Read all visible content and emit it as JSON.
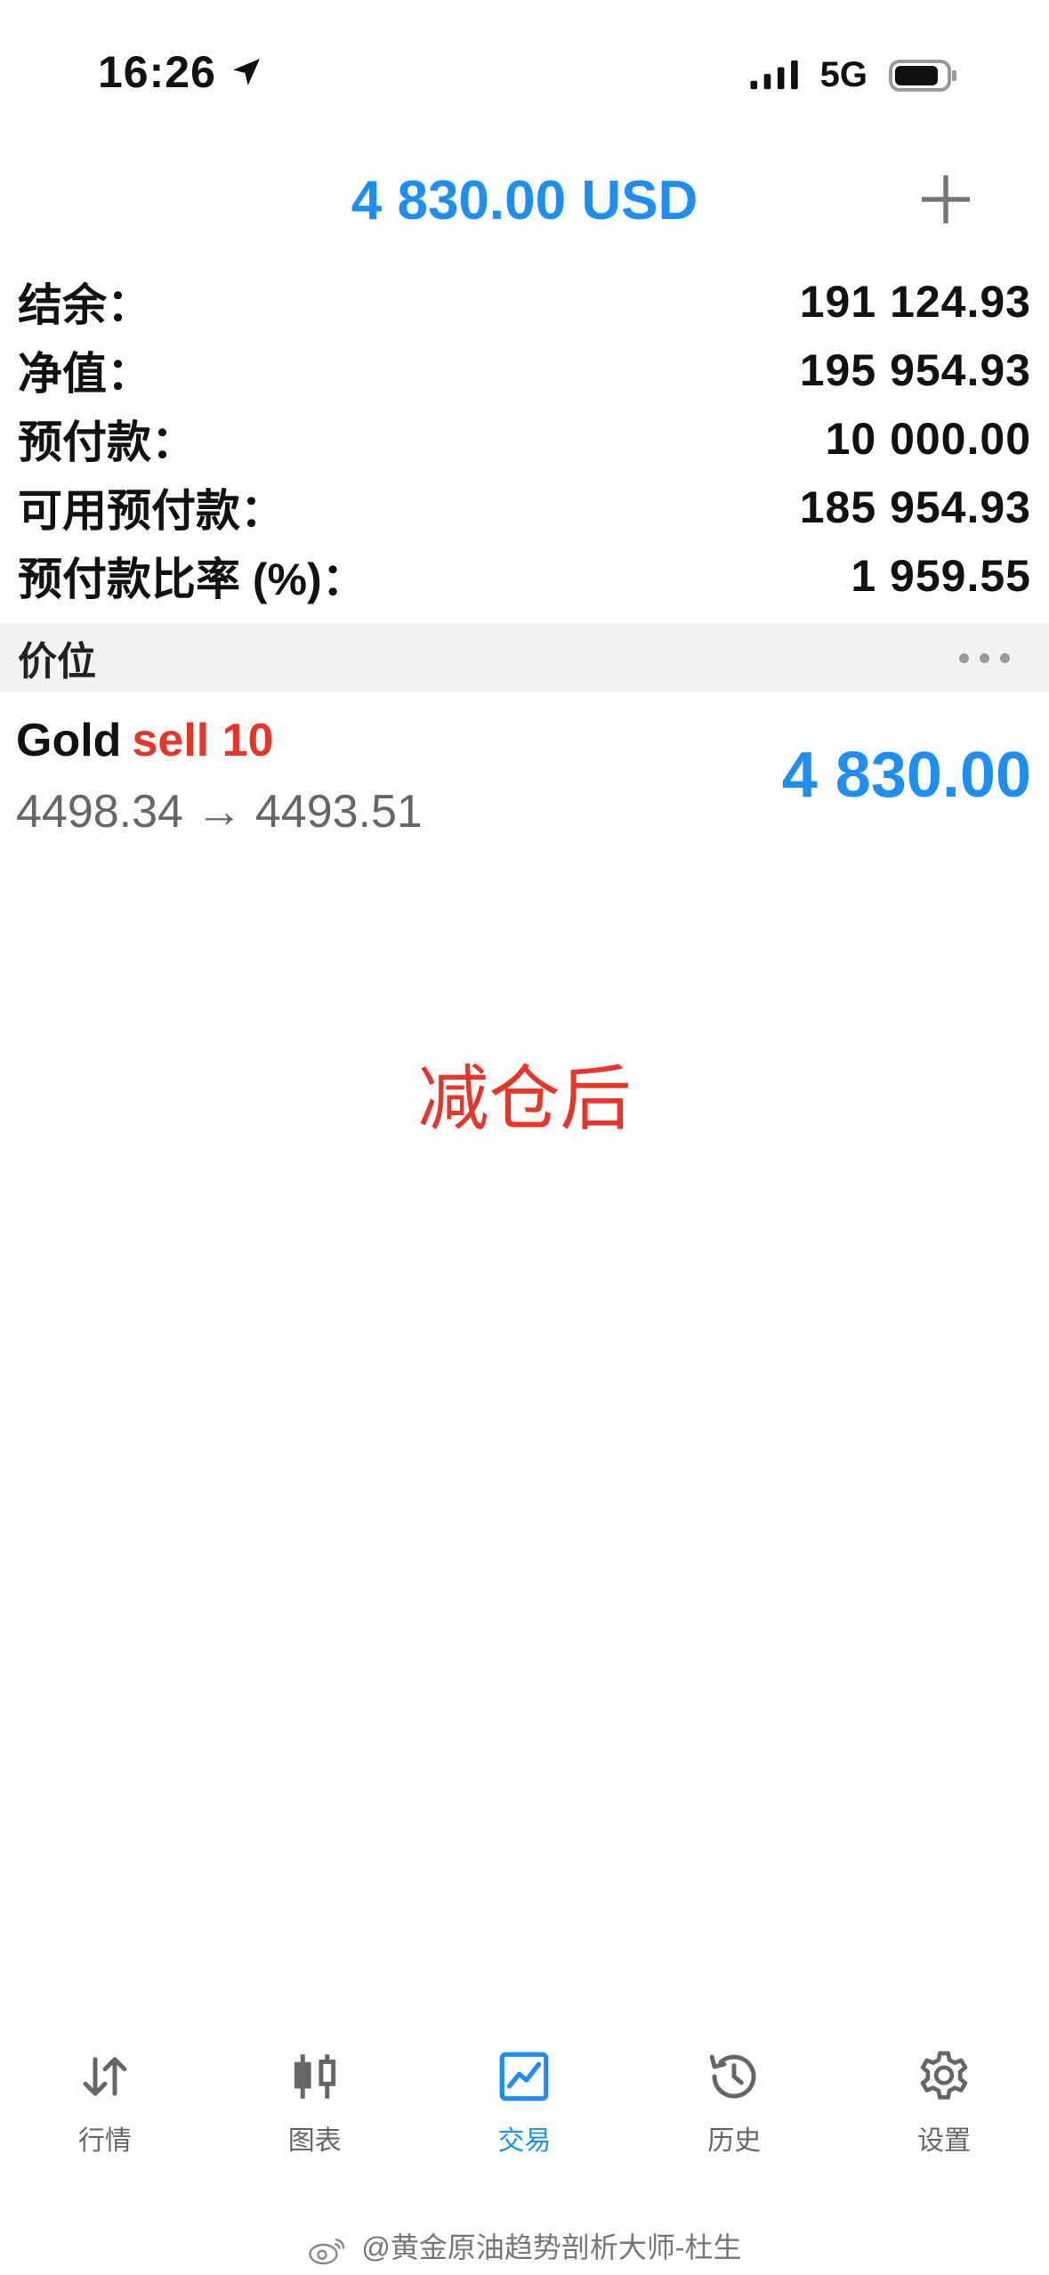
{
  "status_bar": {
    "time": "16:26",
    "network": "5G"
  },
  "header": {
    "title": "4 830.00 USD"
  },
  "summary": [
    {
      "label": "结余：",
      "value": "191 124.93"
    },
    {
      "label": "净值：",
      "value": "195 954.93"
    },
    {
      "label": "预付款：",
      "value": "10 000.00"
    },
    {
      "label": "可用预付款：",
      "value": "185 954.93"
    },
    {
      "label": "预付款比率 (%)：",
      "value": "1 959.55"
    }
  ],
  "section": {
    "title": "价位"
  },
  "position": {
    "symbol": "Gold",
    "side": "sell 10",
    "prices": "4498.34 → 4493.51",
    "profit": "4 830.00"
  },
  "caption": "减仓后",
  "tabs": [
    {
      "label": "行情",
      "icon": "quotes-arrows-icon",
      "active": false
    },
    {
      "label": "图表",
      "icon": "candlestick-chart-icon",
      "active": false
    },
    {
      "label": "交易",
      "icon": "trade-chart-icon",
      "active": true
    },
    {
      "label": "历史",
      "icon": "history-clock-icon",
      "active": false
    },
    {
      "label": "设置",
      "icon": "gear-icon",
      "active": false
    }
  ],
  "watermark": "@黄金原油趋势剖析大师-杜生",
  "colors": {
    "accent": "#1e8ff0",
    "sell": "#e8352a",
    "section_bg": "#f3f3f3"
  }
}
